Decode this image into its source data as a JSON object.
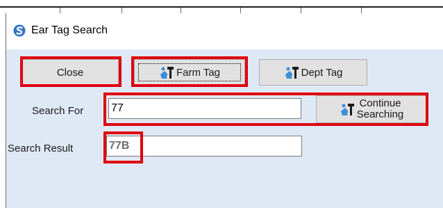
{
  "window": {
    "title": "Ear Tag Search"
  },
  "buttons": {
    "close": "Close",
    "farm_tag": "Farm Tag",
    "dept_tag": "Dept Tag",
    "continue_line1": "Continue",
    "continue_line2": "Searching"
  },
  "search": {
    "label": "Search For",
    "value": "77"
  },
  "result": {
    "label": "Search Result",
    "value": "77B"
  },
  "icons": {
    "app": "app-logo-icon",
    "tag": "ear-tag-wrench-icon"
  },
  "colors": {
    "highlight": "#e0000e",
    "window_bg": "#dfe9f5",
    "button_bg": "#e1e1e1",
    "tag_icon": "#3a8fd9"
  }
}
